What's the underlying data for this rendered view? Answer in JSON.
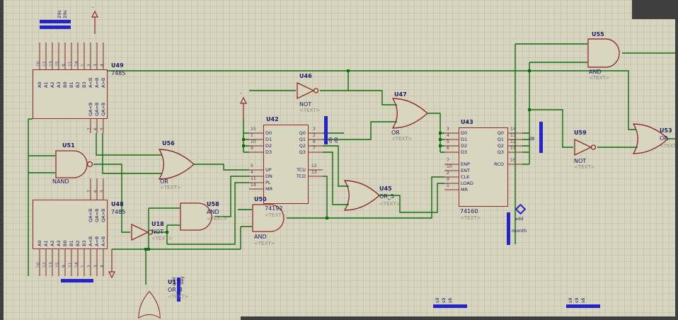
{
  "colors": {
    "background": "#d7d4bf",
    "grid": "#c9c6af",
    "wire": "#0f6e0f",
    "component_outline": "#8f2a2a",
    "label": "#1b1b66",
    "placeholder_grey": "#8e8e7e",
    "terminal_blue": "#2424c8"
  },
  "placeholder": "<TEXT>",
  "chips": {
    "u49": {
      "ref": "U49",
      "value": "7485",
      "top_nums": [
        "10",
        "12",
        "13",
        "15",
        "9",
        "11",
        "14",
        "1",
        "2",
        "3",
        "4"
      ],
      "top_names": [
        "A0",
        "A1",
        "A2",
        "A3",
        "B0",
        "B1",
        "B2",
        "B3",
        "A<B",
        "A=B",
        "A>B"
      ],
      "out_names": [
        "QA<B",
        "QA=B",
        "QA>B"
      ],
      "out_nums": [
        "7",
        "6",
        "5"
      ]
    },
    "u48": {
      "ref": "U48",
      "value": "7485",
      "bot_nums": [
        "10",
        "12",
        "13",
        "15",
        "9",
        "11",
        "14",
        "1",
        "2",
        "3",
        "4"
      ],
      "bot_names": [
        "A0",
        "A1",
        "A2",
        "A3",
        "B0",
        "B1",
        "B2",
        "B3",
        "A<B",
        "A=B",
        "A>B"
      ],
      "out_names": [
        "QA<B",
        "QA=B",
        "QA>B"
      ],
      "out_nums": [
        "7",
        "6",
        "5"
      ]
    },
    "u42": {
      "ref": "U42",
      "value": "74192",
      "left": [
        {
          "n": "15",
          "name": "D0"
        },
        {
          "n": "1",
          "name": "D1"
        },
        {
          "n": "10",
          "name": "D2"
        },
        {
          "n": "9",
          "name": "D3"
        },
        {
          "n": "5",
          "name": "UP"
        },
        {
          "n": "4",
          "name": "DN"
        },
        {
          "n": "11",
          "name": "PL"
        },
        {
          "n": "14",
          "name": "MR"
        }
      ],
      "right": [
        {
          "n": "3",
          "name": "Q0"
        },
        {
          "n": "2",
          "name": "Q1"
        },
        {
          "n": "6",
          "name": "Q2"
        },
        {
          "n": "7",
          "name": "Q3"
        },
        {
          "n": "12",
          "name": "TCU"
        },
        {
          "n": "13",
          "name": "TCD"
        }
      ]
    },
    "u43": {
      "ref": "U43",
      "value": "74160",
      "left": [
        {
          "n": "3",
          "name": "D0"
        },
        {
          "n": "4",
          "name": "D1"
        },
        {
          "n": "5",
          "name": "D2"
        },
        {
          "n": "6",
          "name": "D3"
        },
        {
          "n": "7",
          "name": "ENP"
        },
        {
          "n": "10",
          "name": "ENT"
        },
        {
          "n": "2",
          "name": "CLK"
        },
        {
          "n": "9",
          "name": "LOAD"
        },
        {
          "n": "1",
          "name": "MR"
        }
      ],
      "right": [
        {
          "n": "14",
          "name": "Q0"
        },
        {
          "n": "13",
          "name": "Q1"
        },
        {
          "n": "12",
          "name": "Q2"
        },
        {
          "n": "11",
          "name": "Q3"
        },
        {
          "n": "15",
          "name": "RCO"
        }
      ]
    }
  },
  "gates": {
    "u51": {
      "ref": "U51",
      "type": "NAND"
    },
    "u56": {
      "ref": "U56",
      "type": "OR"
    },
    "u18": {
      "ref": "U18",
      "type": "NOT"
    },
    "u58": {
      "ref": "U58",
      "type": "AND"
    },
    "u50": {
      "ref": "U50",
      "type": "AND"
    },
    "u17": {
      "ref": "U17",
      "type": "OR_8"
    },
    "u46": {
      "ref": "U46",
      "type": "NOT"
    },
    "u47": {
      "ref": "U47",
      "type": "OR"
    },
    "u45": {
      "ref": "U45",
      "type": "OR_5"
    },
    "u55": {
      "ref": "U55",
      "type": "AND"
    },
    "u59": {
      "ref": "U59",
      "type": "NOT"
    },
    "u53": {
      "ref": "U53",
      "type": "OR"
    }
  },
  "terminals": {
    "top_left": [
      "29s",
      "29s"
    ],
    "d9": [
      "d9",
      "d9"
    ],
    "d8": "d8",
    "add": "add",
    "month": "month",
    "add2": "add",
    "day": "day",
    "bottom1": [
      "s9",
      "s9",
      "s6"
    ],
    "bottom2": [
      "s9",
      "s9",
      "s6"
    ],
    "minus": "-"
  }
}
